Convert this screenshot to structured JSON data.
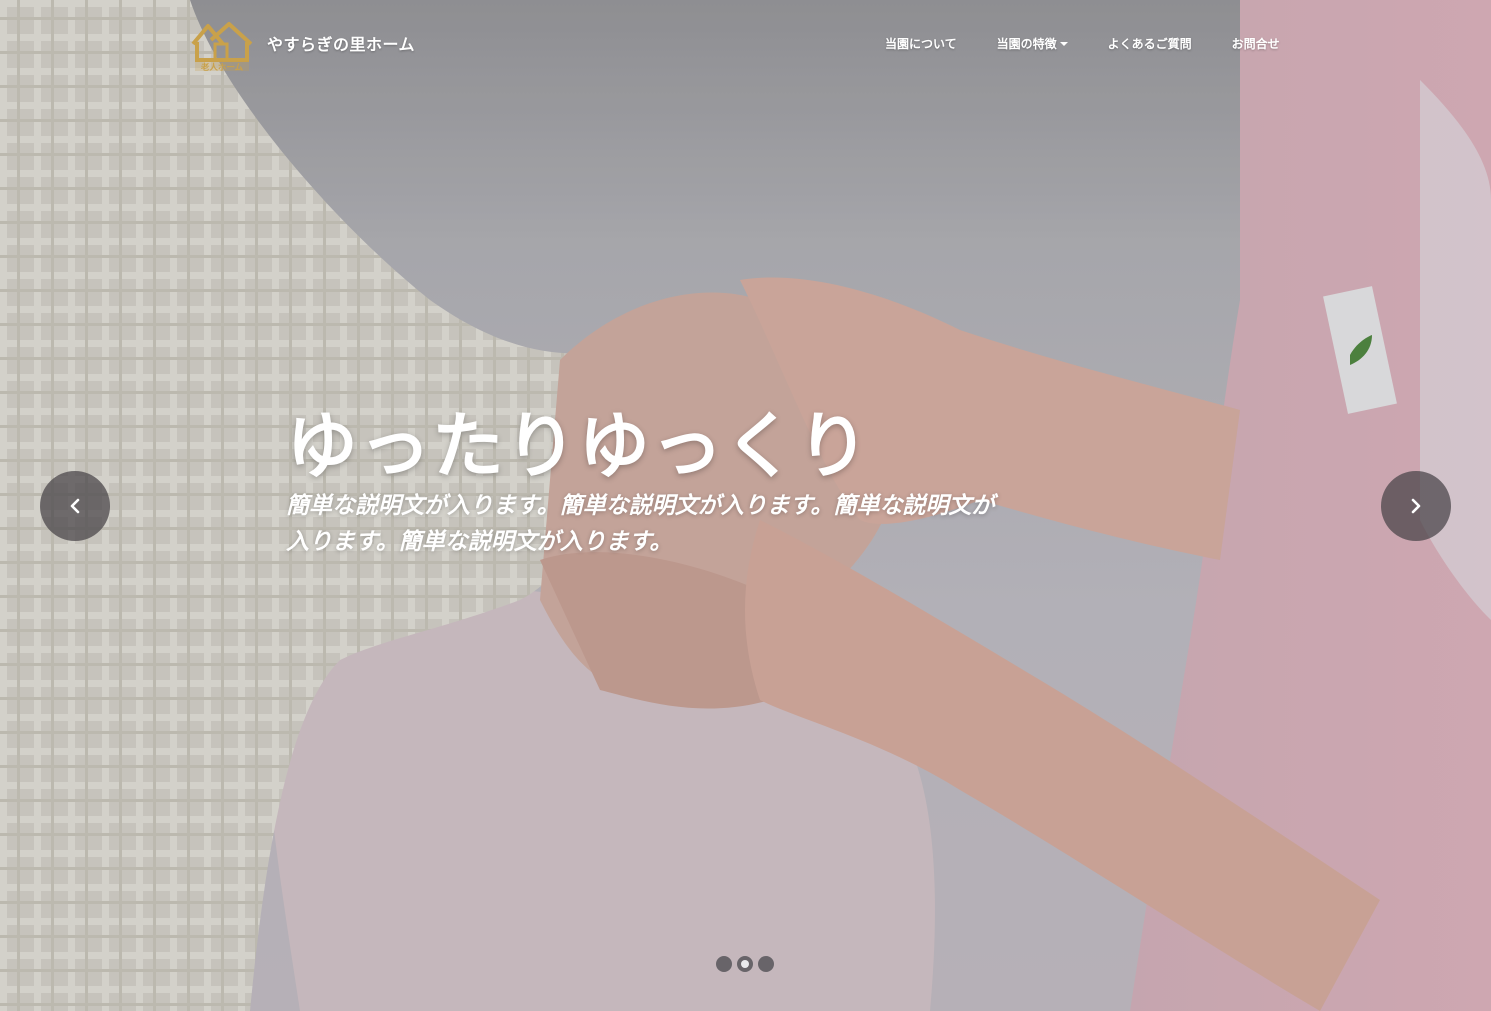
{
  "brand": {
    "name": "やすらぎの里ホーム",
    "logo_icon": "house-logo-icon",
    "logo_text": "老人ホーム",
    "logo_color": "#c9a14a"
  },
  "nav": {
    "items": [
      {
        "label": "当園について",
        "has_dropdown": false
      },
      {
        "label": "当園の特徴",
        "has_dropdown": true
      },
      {
        "label": "よくあるご質問",
        "has_dropdown": false
      },
      {
        "label": "お問合せ",
        "has_dropdown": false
      }
    ]
  },
  "hero": {
    "title": "ゆったりゆっくり",
    "text": "簡単な説明文が入ります。簡単な説明文が入ります。簡単な説明文が入ります。簡単な説明文が入ります。",
    "image_icon": "caregiver-holding-hands-photo"
  },
  "carousel": {
    "prev_icon": "chevron-left-icon",
    "next_icon": "chevron-right-icon",
    "slide_count": 3,
    "active_index": 1
  },
  "colors": {
    "text": "#ffffff",
    "control_bg": "#46424a",
    "indicator_active": "#e9e9ec"
  }
}
